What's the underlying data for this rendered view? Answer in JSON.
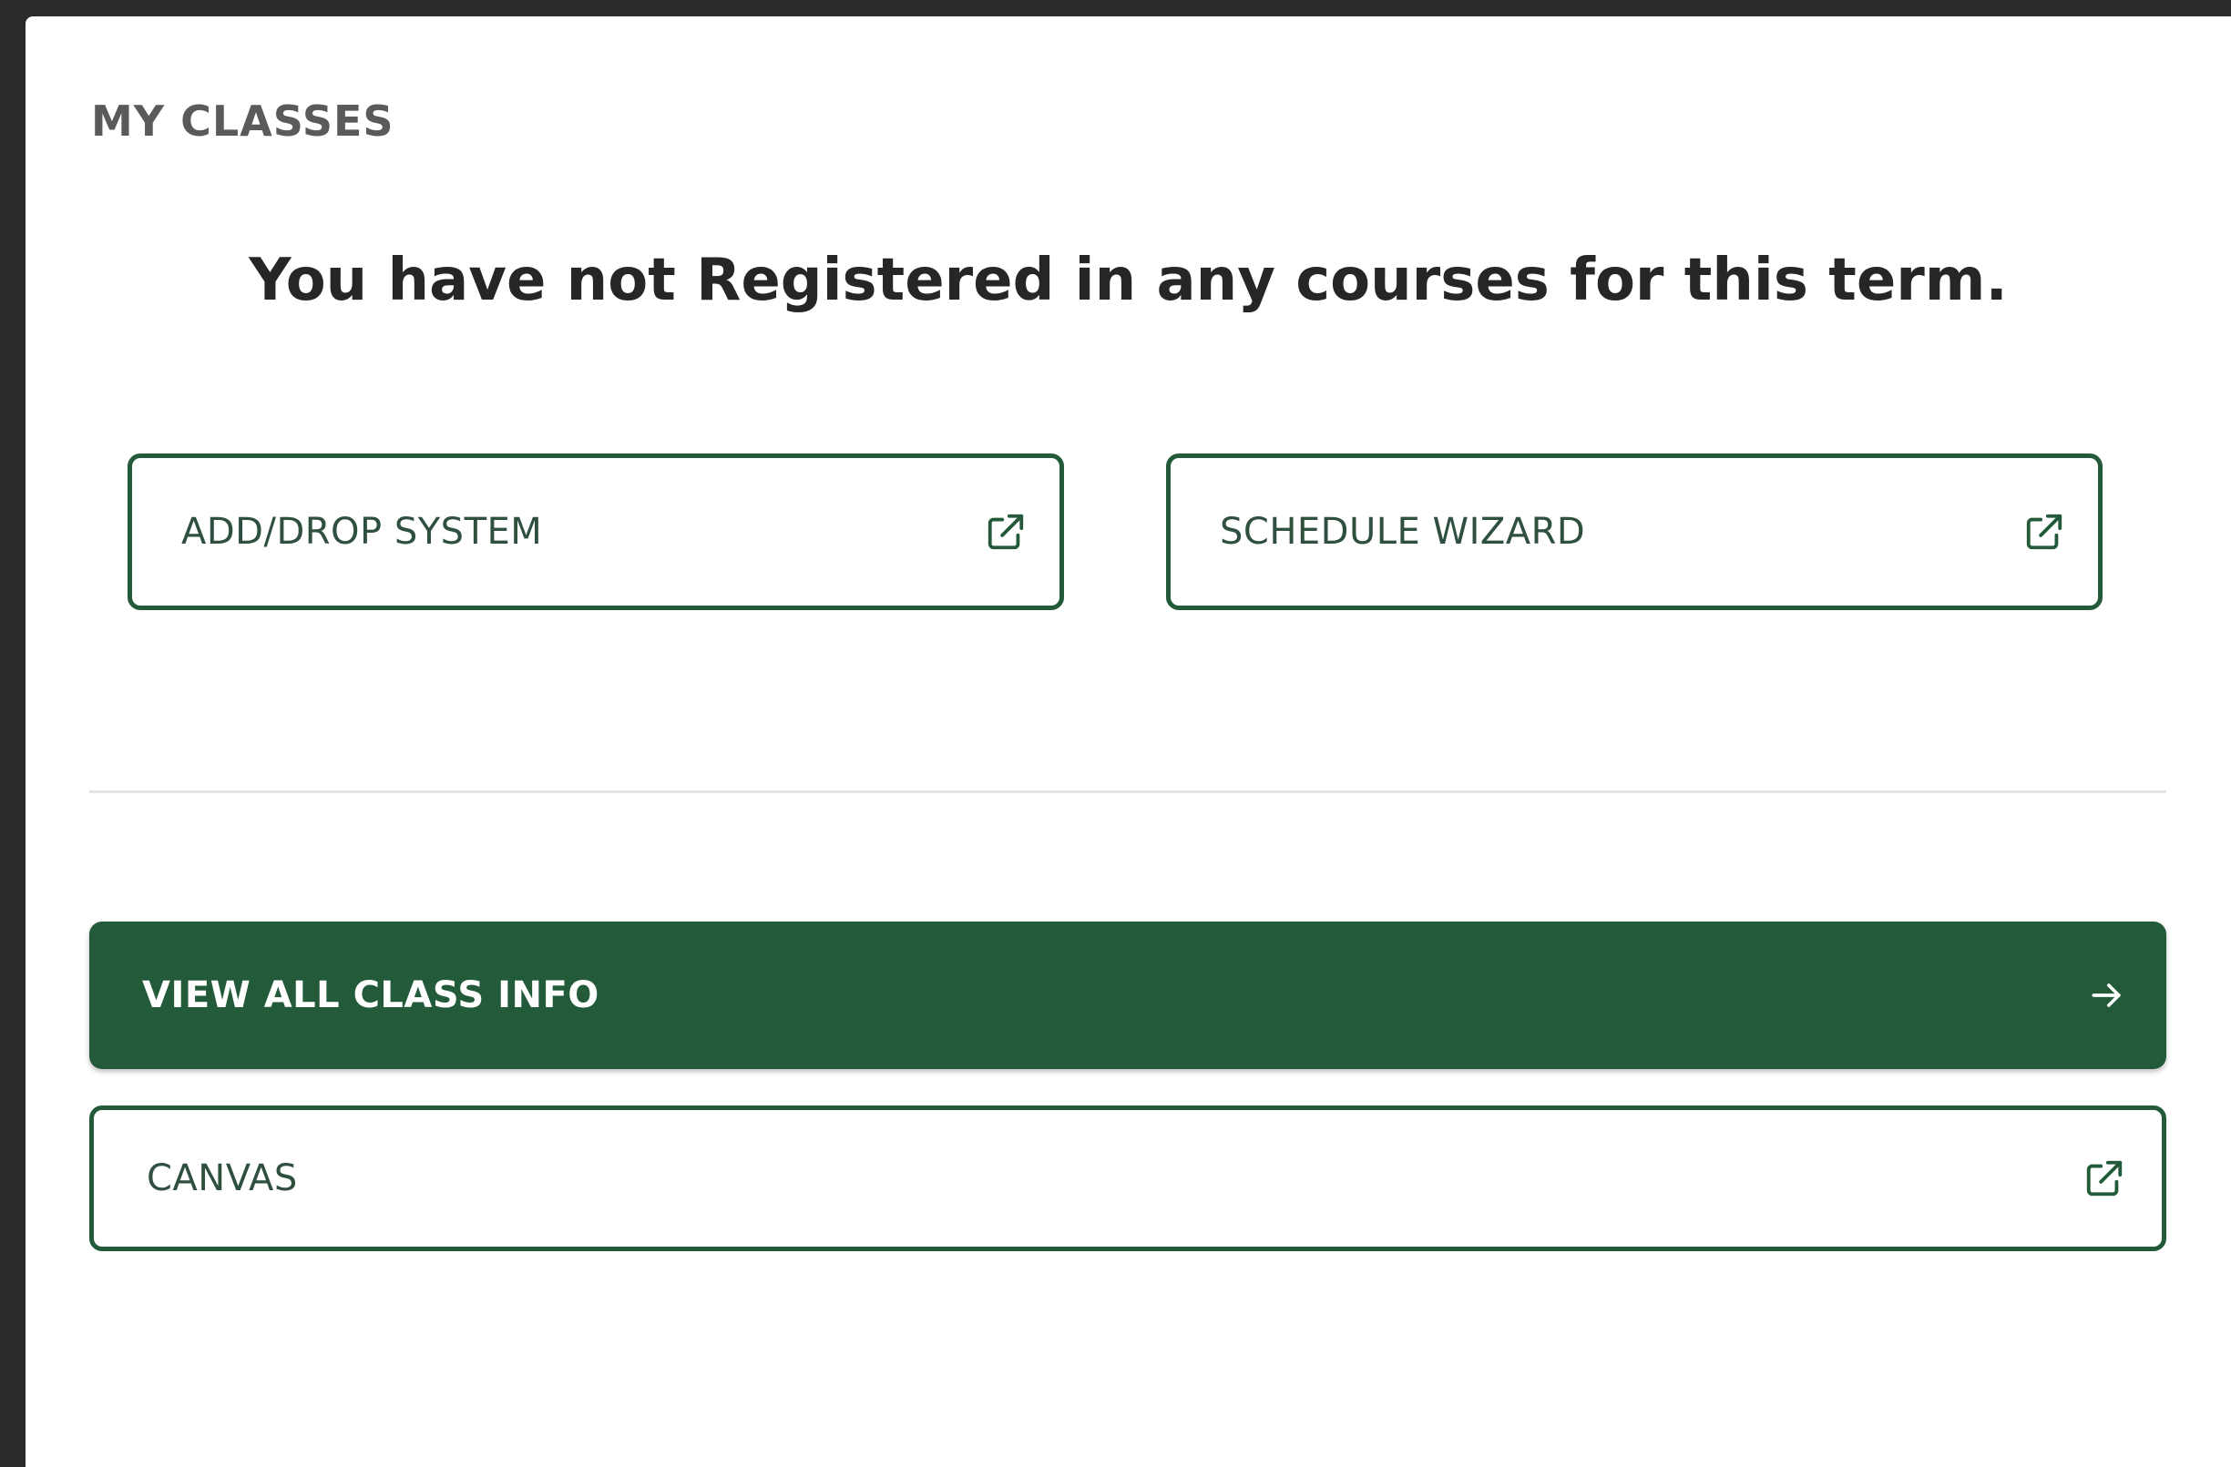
{
  "section": {
    "title": "MY CLASSES",
    "empty_message": "You have not Registered in any courses for this term."
  },
  "buttons": {
    "add_drop": {
      "label": "ADD/DROP SYSTEM",
      "icon": "external-link-icon"
    },
    "schedule_wizard": {
      "label": "SCHEDULE WIZARD",
      "icon": "external-link-icon"
    },
    "view_all": {
      "label": "VIEW ALL CLASS INFO",
      "icon": "arrow-right-icon"
    },
    "canvas": {
      "label": "CANVAS",
      "icon": "external-link-icon"
    }
  },
  "colors": {
    "brand_green": "#235b3a",
    "title_gray": "#5a5a5a",
    "message_dark": "#262626"
  }
}
